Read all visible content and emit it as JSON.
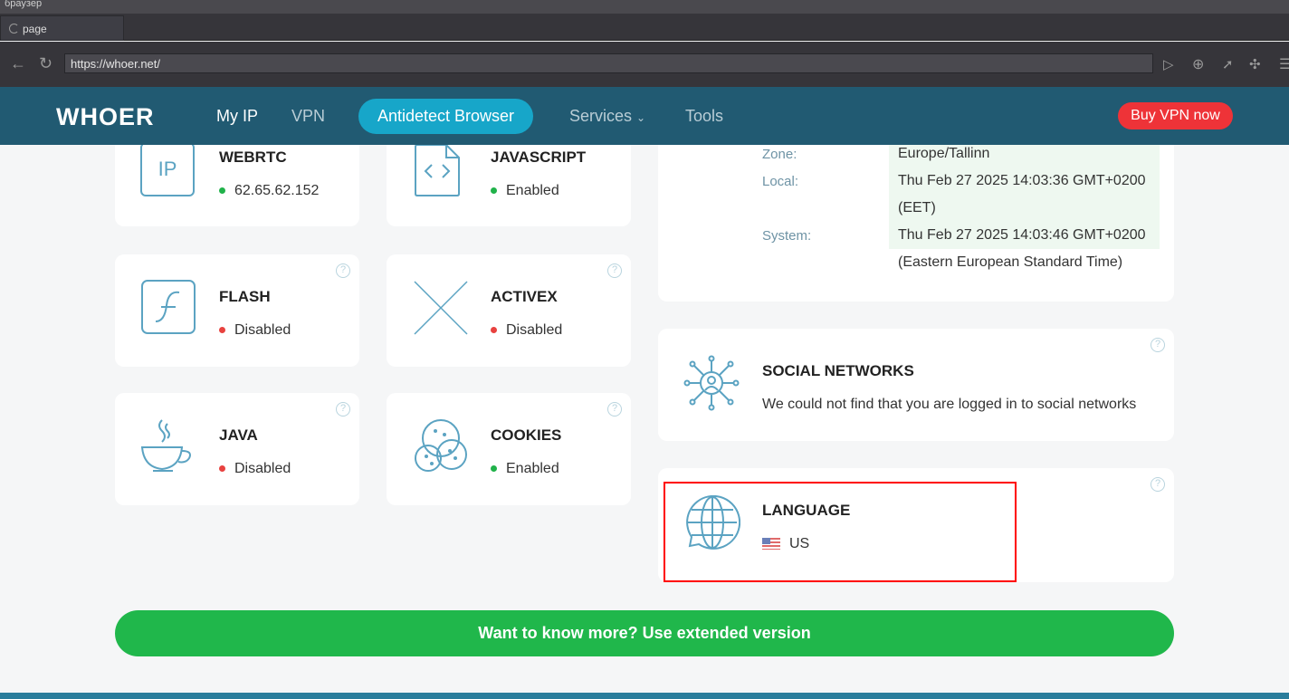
{
  "browser": {
    "window_title": "браузер",
    "tab_label": "page",
    "url": "https://whoer.net/"
  },
  "header": {
    "logo": "WHOER",
    "nav": [
      "My IP",
      "VPN",
      "Antidetect Browser",
      "Services",
      "Tools"
    ],
    "buy": "Buy VPN now"
  },
  "cards": {
    "webrtc": {
      "title": "WEBRTC",
      "value": "62.65.62.152",
      "icon_text": "IP"
    },
    "javascript": {
      "title": "JAVASCRIPT",
      "value": "Enabled"
    },
    "flash": {
      "title": "FLASH",
      "value": "Disabled"
    },
    "activex": {
      "title": "ACTIVEX",
      "value": "Disabled"
    },
    "java": {
      "title": "JAVA",
      "value": "Disabled"
    },
    "cookies": {
      "title": "COOKIES",
      "value": "Enabled"
    }
  },
  "time": {
    "zone_label": "Zone:",
    "zone": "Europe/Tallinn",
    "local_label": "Local:",
    "local": "Thu Feb 27 2025 14:03:36 GMT+0200",
    "local_tz": "(EET)",
    "system_label": "System:",
    "system": "Thu Feb 27 2025 14:03:46 GMT+0200",
    "system_tz": "(Eastern European Standard Time)"
  },
  "social": {
    "title": "SOCIAL NETWORKS",
    "text": "We could not find that you are logged in to social networks"
  },
  "language": {
    "title": "LANGUAGE",
    "value": "US"
  },
  "more_button": "Want to know more? Use extended version",
  "help_glyph": "?"
}
